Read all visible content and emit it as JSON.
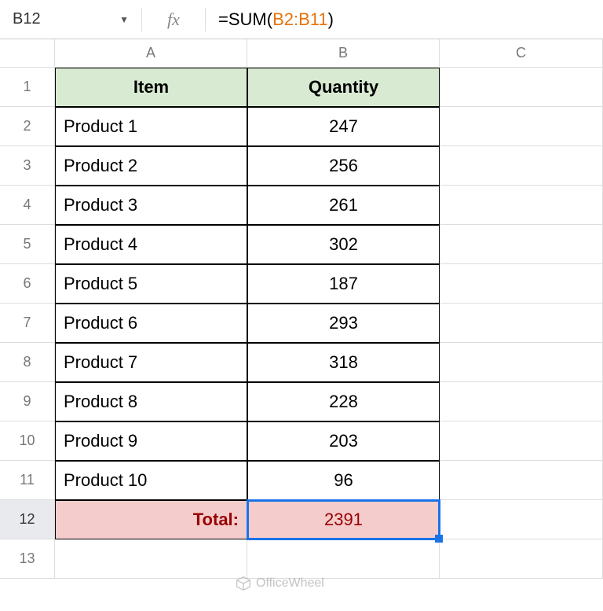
{
  "name_box": "B12",
  "fx_label": "fx",
  "formula": {
    "prefix": "=",
    "fn": "SUM",
    "open": "(",
    "range": "B2:B11",
    "close": ")"
  },
  "columns": [
    "A",
    "B",
    "C"
  ],
  "selected_column": "B",
  "selected_row": "12",
  "header_row": {
    "num": "1",
    "item": "Item",
    "quantity": "Quantity"
  },
  "data_rows": [
    {
      "num": "2",
      "item": "Product 1",
      "qty": "247"
    },
    {
      "num": "3",
      "item": "Product 2",
      "qty": "256"
    },
    {
      "num": "4",
      "item": "Product 3",
      "qty": "261"
    },
    {
      "num": "5",
      "item": "Product 4",
      "qty": "302"
    },
    {
      "num": "6",
      "item": "Product 5",
      "qty": "187"
    },
    {
      "num": "7",
      "item": "Product 6",
      "qty": "293"
    },
    {
      "num": "8",
      "item": "Product 7",
      "qty": "318"
    },
    {
      "num": "9",
      "item": "Product 8",
      "qty": "228"
    },
    {
      "num": "10",
      "item": "Product 9",
      "qty": "203"
    },
    {
      "num": "11",
      "item": "Product 10",
      "qty": "96"
    }
  ],
  "total_row": {
    "num": "12",
    "label": "Total:",
    "value": "2391"
  },
  "empty_row": {
    "num": "13"
  },
  "watermark": "OfficeWheel"
}
